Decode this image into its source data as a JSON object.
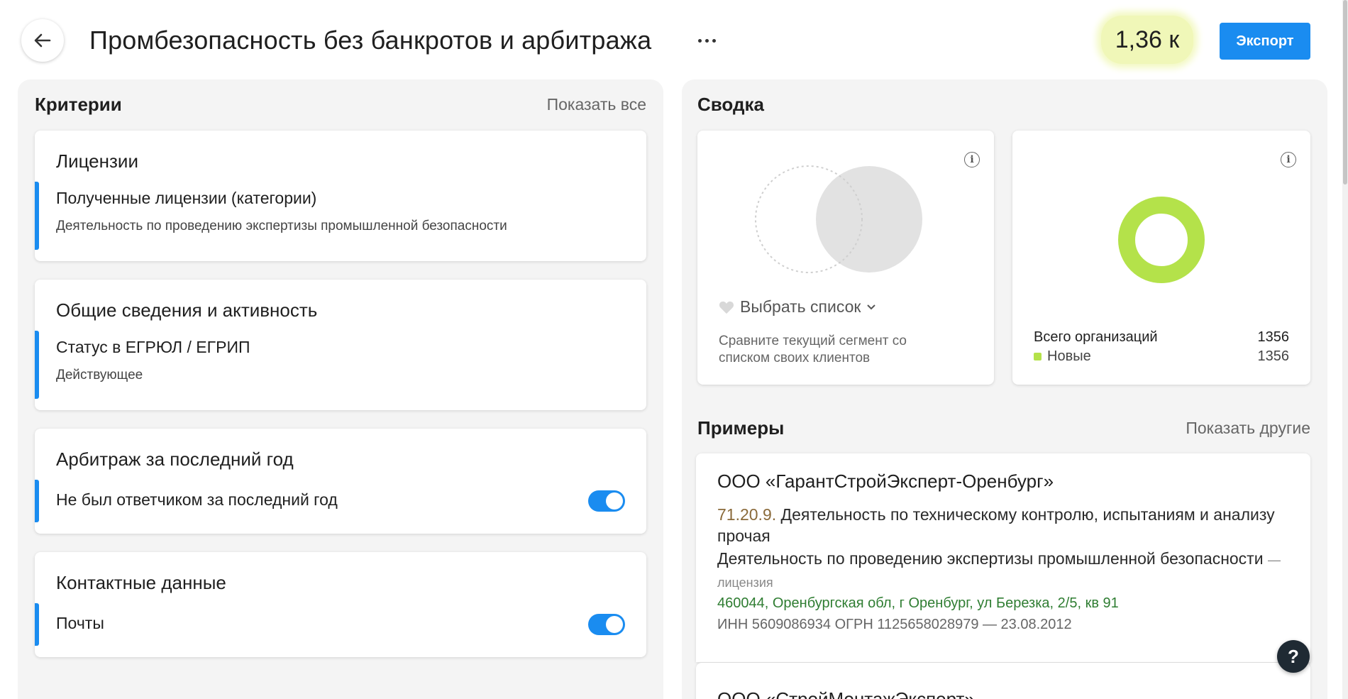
{
  "header": {
    "title": "Промбезопасность без банкротов и арбитража",
    "count": "1,36 к",
    "export_label": "Экспорт"
  },
  "criteria": {
    "heading": "Критерии",
    "show_all": "Показать все",
    "groups": [
      {
        "title": "Лицензии",
        "label": "Полученные лицензии (категории)",
        "value": "Деятельность по проведению экспертизы промышленной безопасности"
      },
      {
        "title": "Общие сведения и активность",
        "label": "Статус в ЕГРЮЛ / ЕГРИП",
        "value": "Действующее"
      },
      {
        "title": "Арбитраж за последний год",
        "label": "Не был ответчиком за последний год",
        "toggle_on": true
      },
      {
        "title": "Контактные данные",
        "label": "Почты",
        "toggle_on": true
      }
    ]
  },
  "summary": {
    "heading": "Сводка",
    "compare": {
      "select_label": "Выбрать список",
      "hint": "Сравните текущий сегмент со списком своих клиентов"
    },
    "stats": {
      "total_label": "Всего организаций",
      "total_value": "1356",
      "new_label": "Новые",
      "new_value": "1356",
      "accent_color": "#b4e24a"
    }
  },
  "examples": {
    "heading": "Примеры",
    "show_other": "Показать другие",
    "items": [
      {
        "name": "ООО «ГарантСтройЭксперт-Оренбург»",
        "okved_code": "71.20.9.",
        "okved_text": "Деятельность по техническому контролю, испытаниям и анализу прочая",
        "license_text": "Деятельность по проведению экспертизы промышленной безопасности",
        "license_suffix": "— лицензия",
        "address": "460044, Оренбургская обл, г Оренбург, ул Березка, 2/5, кв 91",
        "ids": "ИНН 5609086934 ОГРН 1125658028979 — 23.08.2012"
      },
      {
        "name": "ООО «СтройМонтажЭксперт»"
      }
    ]
  },
  "help_label": "?",
  "colors": {
    "primary": "#1a8cf0",
    "badge_bg": "#f0f7b8",
    "panel_bg": "#f4f4f4"
  }
}
